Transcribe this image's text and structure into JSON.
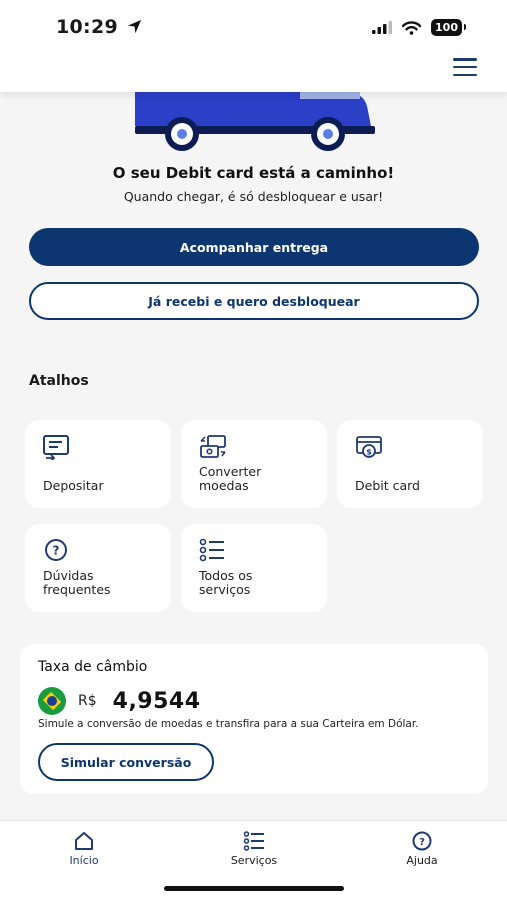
{
  "status_bar": {
    "time": "10:29",
    "battery": "100"
  },
  "delivery": {
    "title": "O seu Debit card está a caminho!",
    "subtitle": "Quando chegar, é só desbloquear e usar!",
    "track_button": "Acompanhar entrega",
    "unlock_button": "Já recebi e quero desbloquear"
  },
  "shortcuts": {
    "title": "Atalhos",
    "items": [
      {
        "label": "Depositar",
        "icon": "deposit-icon"
      },
      {
        "label": "Converter\nmoedas",
        "icon": "currency-exchange-icon"
      },
      {
        "label": "Debit card",
        "icon": "debit-card-icon"
      },
      {
        "label": "Dúvidas\nfrequentes",
        "icon": "question-icon"
      },
      {
        "label": "Todos os\nserviços",
        "icon": "services-list-icon"
      }
    ]
  },
  "exchange_rate": {
    "title": "Taxa de câmbio",
    "currency": "R$",
    "value": "4,9544",
    "flag_icon": "brazil-flag-icon",
    "description": "Simule a conversão de moedas e transfira para a sua Carteira em Dólar.",
    "simulate_button": "Simular conversão"
  },
  "bottom_nav": {
    "items": [
      {
        "label": "Início",
        "icon": "home-icon",
        "active": true
      },
      {
        "label": "Serviços",
        "icon": "services-list-icon",
        "active": false
      },
      {
        "label": "Ajuda",
        "icon": "help-icon",
        "active": false
      }
    ]
  },
  "colors": {
    "primary": "#0d3570",
    "accent": "#2c3fc7",
    "background": "#f5f5f5"
  }
}
